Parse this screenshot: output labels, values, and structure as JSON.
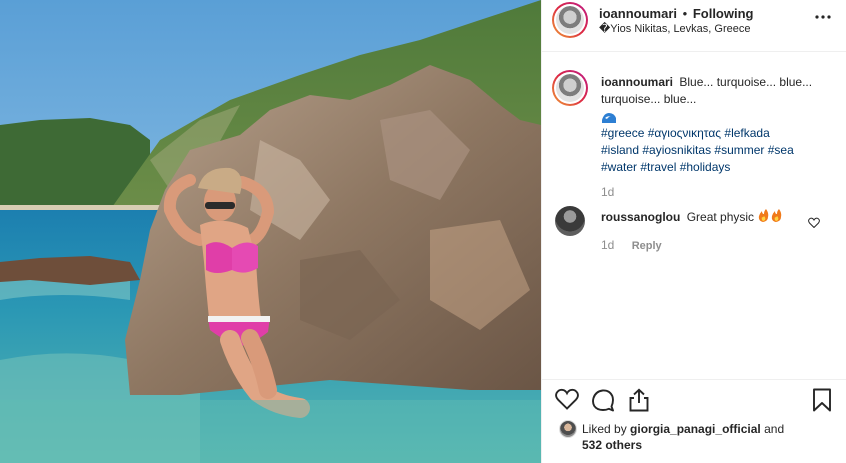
{
  "post": {
    "username": "ioannoumari",
    "separator": "•",
    "follow_status": "Following",
    "location": "�Yios Nikitas, Levkas, Greece",
    "more_icon": "more-dots-icon"
  },
  "caption": {
    "username": "ioannoumari",
    "text_line1": "Blue... turquoise... blue...",
    "text_line2": "turquoise... blue...",
    "emoji_icon": "wave-icon",
    "hashtags_line1": "#greece #αγιοςνικητας #lefkada",
    "hashtags_line2": "#island #ayiosnikitas #summer #sea",
    "hashtags_line3": "#water #travel #holidays",
    "time": "1d"
  },
  "comment": {
    "username": "roussanoglou",
    "text": "Great physic",
    "emoji_icon": "fire-icon",
    "time": "1d",
    "reply_label": "Reply"
  },
  "actions": {
    "like_icon": "heart-icon",
    "comment_icon": "comment-icon",
    "share_icon": "share-icon",
    "save_icon": "bookmark-icon"
  },
  "likes": {
    "prefix": "Liked by",
    "user": "giorgia_panagi_official",
    "and": "and",
    "others": "532 others"
  }
}
